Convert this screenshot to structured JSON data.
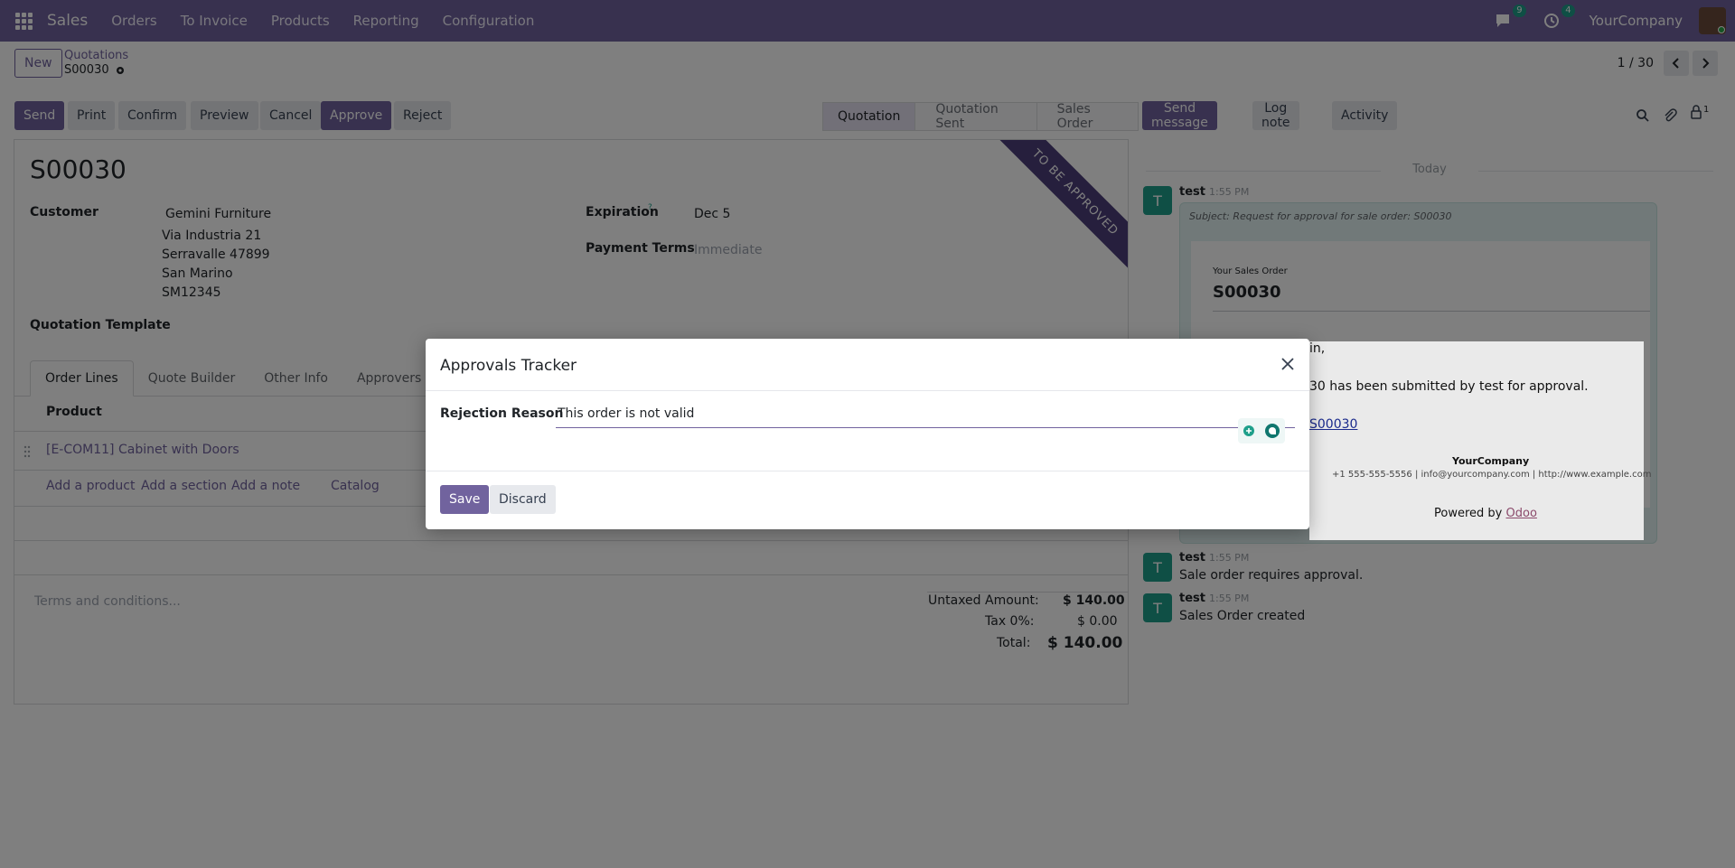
{
  "topbar": {
    "app_name": "Sales",
    "menu": [
      "Orders",
      "To Invoice",
      "Products",
      "Reporting",
      "Configuration"
    ],
    "messages_count": "9",
    "activities_count": "4",
    "company": "YourCompany"
  },
  "control_panel": {
    "new_label": "New",
    "breadcrumb_parent": "Quotations",
    "breadcrumb_current": "S00030",
    "pager": "1 / 30"
  },
  "actions": {
    "send": "Send",
    "print": "Print",
    "confirm": "Confirm",
    "preview": "Preview",
    "cancel": "Cancel",
    "approve": "Approve",
    "reject": "Reject"
  },
  "stages": [
    "Quotation",
    "Quotation Sent",
    "Sales Order"
  ],
  "active_stage": "Quotation",
  "form": {
    "title": "S00030",
    "ribbon": "TO BE APPROVED",
    "customer_label": "Customer",
    "customer_name": "Gemini Furniture",
    "address": [
      "Via Industria 21",
      "Serravalle 47899",
      "San Marino",
      "SM12345"
    ],
    "expiration_label": "Expiration",
    "expiration_help": "?",
    "expiration_value": "Dec 5",
    "payment_terms_label": "Payment Terms",
    "payment_terms_placeholder": "Immediate",
    "quotation_template_label": "Quotation Template",
    "tabs": [
      "Order Lines",
      "Quote Builder",
      "Other Info",
      "Approvers"
    ],
    "product_header": "Product",
    "line_product": "[E-COM11] Cabinet with Doors",
    "add_links": [
      "Add a product",
      "Add a section",
      "Add a note",
      "Catalog"
    ],
    "terms_placeholder": "Terms and conditions...",
    "untaxed_label": "Untaxed Amount:",
    "untaxed_value": "$ 140.00",
    "tax_label": "Tax 0%:",
    "tax_value": "$ 0.00",
    "total_label": "Total:",
    "total_value": "$ 140.00"
  },
  "chatter": {
    "send_message": "Send message",
    "log_note": "Log note",
    "activity": "Activity",
    "followers_count": "1",
    "date_separator": "Today",
    "messages": [
      {
        "author": "test",
        "time": "1:55 PM",
        "subject": "Subject: Request for approval for sale order: S00030"
      },
      {
        "author": "test",
        "time": "1:55 PM",
        "body": "Sale order requires approval."
      },
      {
        "author": "test",
        "time": "1:55 PM",
        "body": "Sales Order created"
      }
    ],
    "mail": {
      "caption": "Your Sales Order",
      "ref": "S00030",
      "greeting_fragment": "in,",
      "body_fragment": "30 has been submitted by test for approval.",
      "link_fragment": "S00030",
      "company": "YourCompany",
      "contact": "+1 555-555-5556 | info@yourcompany.com | http://www.example.com",
      "powered_by": "Powered by",
      "powered_link": "Odoo"
    }
  },
  "dialog": {
    "title": "Approvals Tracker",
    "field_label": "Rejection Reason",
    "field_value": "This order is not valid",
    "save": "Save",
    "discard": "Discard"
  }
}
